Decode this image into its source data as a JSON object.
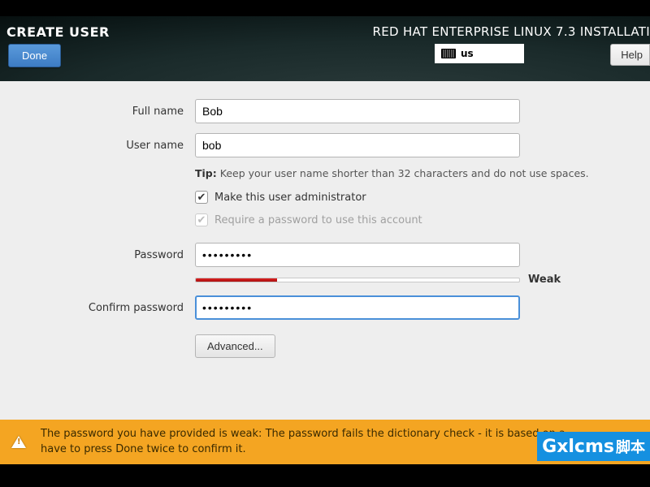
{
  "header": {
    "title": "CREATE USER",
    "subtitle": "RED HAT ENTERPRISE LINUX 7.3 INSTALLATI",
    "done_label": "Done",
    "keyboard_layout": "us",
    "help_label": "Help"
  },
  "form": {
    "full_name_label": "Full name",
    "full_name_value": "Bob",
    "user_name_label": "User name",
    "user_name_value": "bob",
    "tip_prefix": "Tip:",
    "tip_text": "Keep your user name shorter than 32 characters and do not use spaces.",
    "admin_checkbox_label": "Make this user administrator",
    "admin_checked": true,
    "require_pw_label": "Require a password to use this account",
    "require_pw_checked": true,
    "password_label": "Password",
    "password_value": "•••••••••",
    "strength_label": "Weak",
    "strength_percent": 25,
    "confirm_label": "Confirm password",
    "confirm_value": "•••••••••",
    "advanced_label": "Advanced..."
  },
  "warning": {
    "text_line1": "The password you have provided is weak: The password fails the dictionary check - it is based on a",
    "text_line2": "have to press Done twice to confirm it."
  },
  "watermark": {
    "brand": "Gxlcms",
    "suffix": "脚本"
  }
}
